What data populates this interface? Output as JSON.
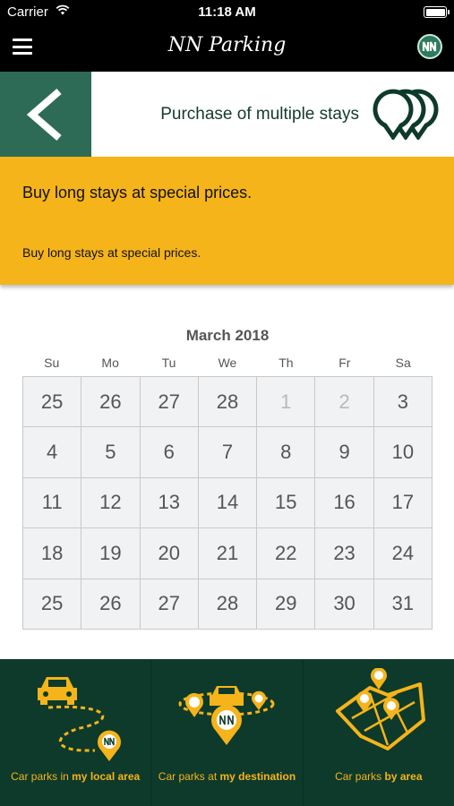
{
  "status_bar": {
    "carrier": "Carrier",
    "time": "11:18 AM"
  },
  "nav": {
    "title": "NN Parking",
    "logo_text": "NN"
  },
  "header": {
    "title": "Purchase of multiple stays"
  },
  "banner": {
    "headline": "Buy long stays at special prices.",
    "subtext": "Buy long stays at special prices."
  },
  "calendar": {
    "month": "March 2018",
    "weekdays": [
      "Su",
      "Mo",
      "Tu",
      "We",
      "Th",
      "Fr",
      "Sa"
    ],
    "days": [
      {
        "label": "25",
        "disabled": false
      },
      {
        "label": "26",
        "disabled": false
      },
      {
        "label": "27",
        "disabled": false
      },
      {
        "label": "28",
        "disabled": false
      },
      {
        "label": "1",
        "disabled": true
      },
      {
        "label": "2",
        "disabled": true
      },
      {
        "label": "3",
        "disabled": false
      },
      {
        "label": "4",
        "disabled": false
      },
      {
        "label": "5",
        "disabled": false
      },
      {
        "label": "6",
        "disabled": false
      },
      {
        "label": "7",
        "disabled": false
      },
      {
        "label": "8",
        "disabled": false
      },
      {
        "label": "9",
        "disabled": false
      },
      {
        "label": "10",
        "disabled": false
      },
      {
        "label": "11",
        "disabled": false
      },
      {
        "label": "12",
        "disabled": false
      },
      {
        "label": "13",
        "disabled": false
      },
      {
        "label": "14",
        "disabled": false
      },
      {
        "label": "15",
        "disabled": false
      },
      {
        "label": "16",
        "disabled": false
      },
      {
        "label": "17",
        "disabled": false
      },
      {
        "label": "18",
        "disabled": false
      },
      {
        "label": "19",
        "disabled": false
      },
      {
        "label": "20",
        "disabled": false
      },
      {
        "label": "21",
        "disabled": false
      },
      {
        "label": "22",
        "disabled": false
      },
      {
        "label": "23",
        "disabled": false
      },
      {
        "label": "24",
        "disabled": false
      },
      {
        "label": "25",
        "disabled": false
      },
      {
        "label": "26",
        "disabled": false
      },
      {
        "label": "27",
        "disabled": false
      },
      {
        "label": "28",
        "disabled": false
      },
      {
        "label": "29",
        "disabled": false
      },
      {
        "label": "30",
        "disabled": false
      },
      {
        "label": "31",
        "disabled": false
      }
    ]
  },
  "bottom_nav": [
    {
      "prefix": "Car parks in ",
      "bold": "my local area",
      "icon": "car-route-icon"
    },
    {
      "prefix": "Car parks at ",
      "bold": "my destination",
      "icon": "destination-pin-icon"
    },
    {
      "prefix": "Car parks ",
      "bold": "by area",
      "icon": "area-map-icon"
    }
  ],
  "colors": {
    "accent": "#f5b41a",
    "dark_green": "#0e3a2b",
    "back_green": "#2e6b57",
    "title_green": "#163a2f"
  }
}
